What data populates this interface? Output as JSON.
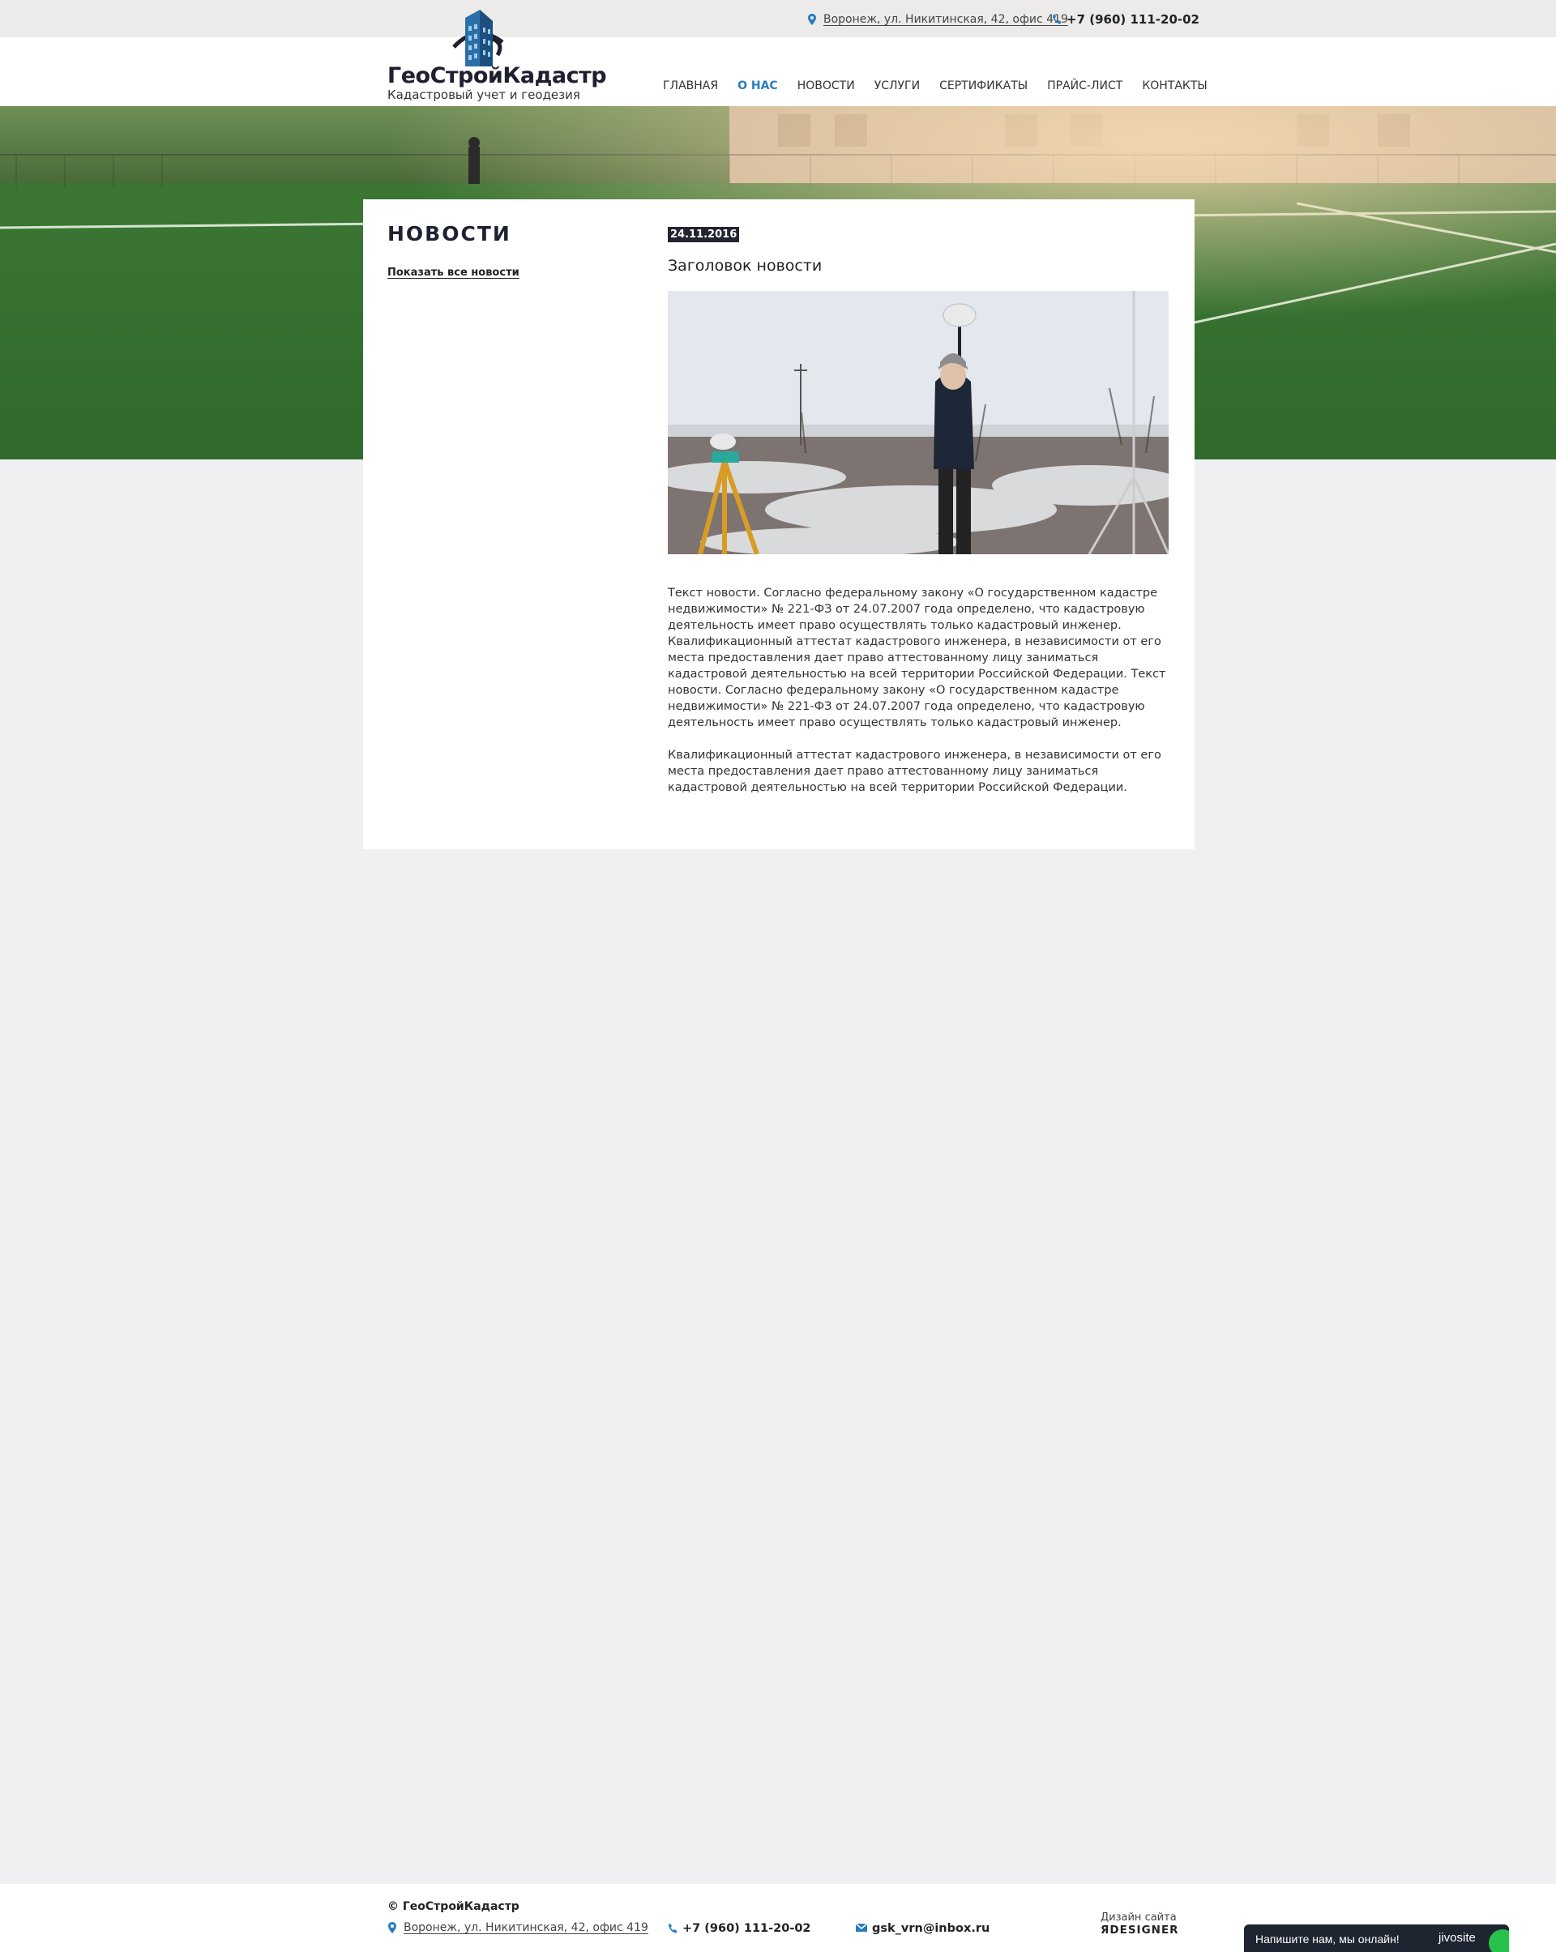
{
  "topbar": {
    "address": "Воронеж, ул. Никитинская, 42, офис 419",
    "phone": "+7 (960) 111-20-02"
  },
  "logo": {
    "name": "ГеоСтройКадастр",
    "subtitle": "Кадастровый учет и геодезия"
  },
  "nav": {
    "items": [
      "ГЛАВНАЯ",
      "О НАС",
      "НОВОСТИ",
      "УСЛУГИ",
      "СЕРТИФИКАТЫ",
      "ПРАЙС-ЛИСТ",
      "КОНТАКТЫ"
    ],
    "active": "О НАС"
  },
  "sidebar": {
    "title": "НОВОСТИ",
    "all_news_link": "Показать все новости"
  },
  "article": {
    "date": "24.11.2016",
    "title": "Заголовок новости",
    "paragraph1": "Текст новости. Согласно федеральному закону «О государственном кадастре недвижимости» № 221-ФЗ от 24.07.2007 года определено, что кадастровую деятельность имеет право осуществлять только кадастровый инженер. Квалификационный аттестат кадастрового инженера, в независимости от его места предоставления дает право аттестованному лицу заниматься кадастровой деятельностью на всей территории Российской Федерации. Текст новости. Согласно федеральному закону «О государственном кадастре недвижимости» № 221-ФЗ от 24.07.2007 года определено, что кадастровую деятельность имеет право осуществлять только кадастровый инженер.",
    "paragraph2": "Квалификационный аттестат кадастрового инженера, в независимости от его места предоставления дает право аттестованному лицу заниматься кадастровой деятельностью на всей территории Российской Федерации."
  },
  "footer": {
    "copyright": "© ГеоСтройКадастр",
    "address": "Воронеж, ул. Никитинская, 42, офис 419",
    "phone": "+7 (960) 111-20-02",
    "email": "gsk_vrn@inbox.ru",
    "design_label": "Дизайн сайта",
    "design_brand": "ЯDESIGNER"
  },
  "chat": {
    "text": "Напишите нам, мы онлайн!",
    "brand": "jivosite"
  },
  "colors": {
    "accent": "#2a7cc1",
    "dark": "#1f2133",
    "page_bg": "#eff0f1"
  }
}
